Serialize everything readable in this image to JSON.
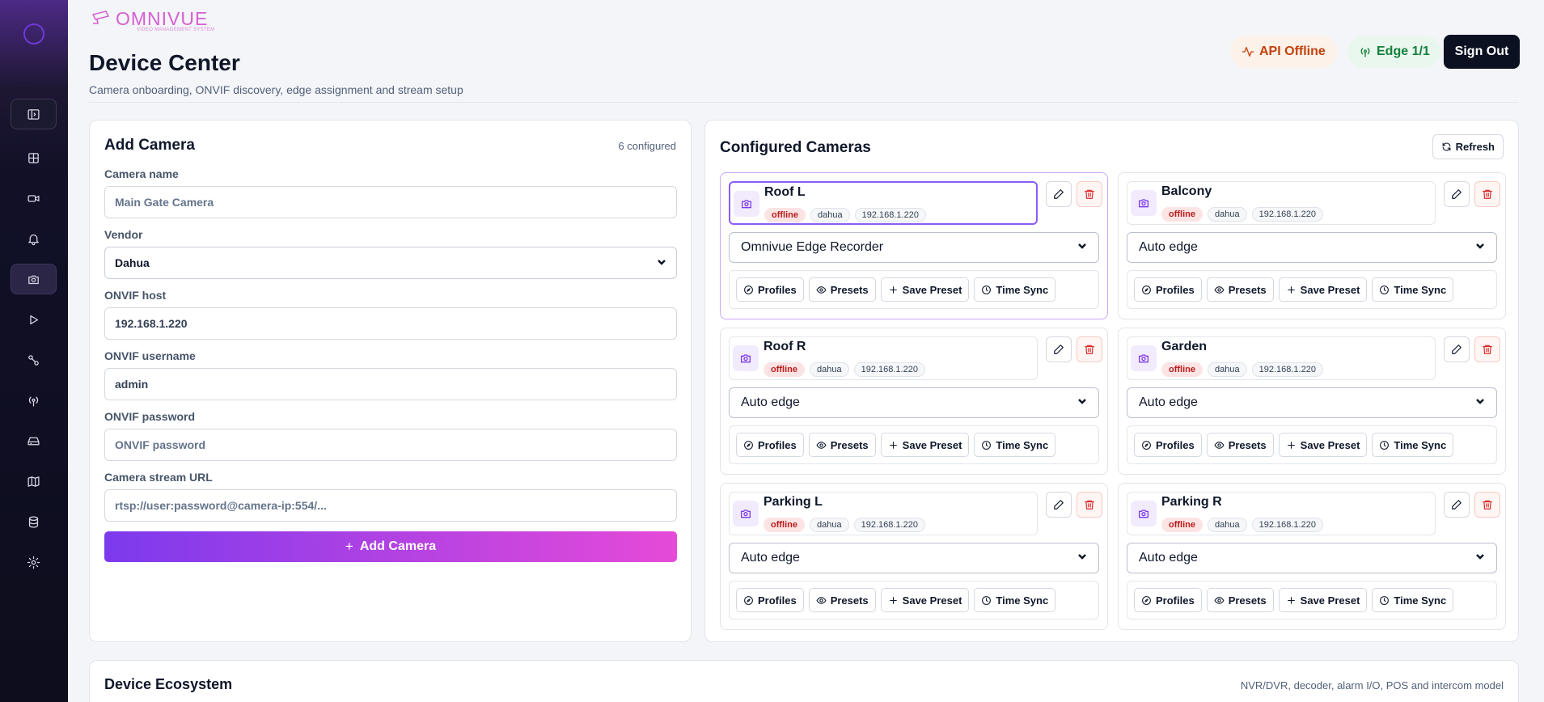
{
  "brand": {
    "name": "OMNIVUE",
    "tagline": "VIDEO MANAGEMENT SYSTEM"
  },
  "colors": {
    "accent": "#7c3aed",
    "accent_end": "#e64ad8",
    "danger": "#dc2626",
    "success": "#15803d",
    "warning": "#c2410c",
    "sidebar_bg": "#111027"
  },
  "sidebar": {
    "items": [
      {
        "icon": "sidebar-toggle-icon"
      },
      {
        "icon": "dashboard-grid-icon"
      },
      {
        "icon": "video-camera-icon"
      },
      {
        "icon": "bell-icon"
      },
      {
        "icon": "camera-icon",
        "active": true
      },
      {
        "icon": "play-icon"
      },
      {
        "icon": "workflow-icon"
      },
      {
        "icon": "antenna-icon"
      },
      {
        "icon": "storage-drive-icon"
      },
      {
        "icon": "map-icon"
      },
      {
        "icon": "database-icon"
      },
      {
        "icon": "gear-icon"
      }
    ]
  },
  "header": {
    "title": "Device Center",
    "subtitle": "Camera onboarding, ONVIF discovery, edge assignment and stream setup",
    "api_status": "API Offline",
    "edge_status": "Edge 1/1",
    "sign_out": "Sign Out"
  },
  "add_camera": {
    "title": "Add Camera",
    "configured_count": "6 configured",
    "fields": {
      "name_label": "Camera name",
      "name_placeholder": "Main Gate Camera",
      "vendor_label": "Vendor",
      "vendor_value": "Dahua",
      "host_label": "ONVIF host",
      "host_value": "192.168.1.220",
      "username_label": "ONVIF username",
      "username_value": "admin",
      "password_label": "ONVIF password",
      "password_placeholder": "ONVIF password",
      "url_label": "Camera stream URL",
      "url_placeholder": "rtsp://user:password@camera-ip:554/..."
    },
    "submit_label": "Add Camera"
  },
  "cameras_panel": {
    "title": "Configured Cameras",
    "refresh_label": "Refresh",
    "action_labels": {
      "profiles": "Profiles",
      "presets": "Presets",
      "save_preset": "Save Preset",
      "time_sync": "Time Sync"
    },
    "cameras": [
      {
        "name": "Roof L",
        "status": "offline",
        "vendor": "dahua",
        "ip": "192.168.1.220",
        "edge": "Omnivue Edge Recorder"
      },
      {
        "name": "Balcony",
        "status": "offline",
        "vendor": "dahua",
        "ip": "192.168.1.220",
        "edge": "Auto edge"
      },
      {
        "name": "Roof R",
        "status": "offline",
        "vendor": "dahua",
        "ip": "192.168.1.220",
        "edge": "Auto edge"
      },
      {
        "name": "Garden",
        "status": "offline",
        "vendor": "dahua",
        "ip": "192.168.1.220",
        "edge": "Auto edge"
      },
      {
        "name": "Parking L",
        "status": "offline",
        "vendor": "dahua",
        "ip": "192.168.1.220",
        "edge": "Auto edge"
      },
      {
        "name": "Parking R",
        "status": "offline",
        "vendor": "dahua",
        "ip": "192.168.1.220",
        "edge": "Auto edge"
      }
    ]
  },
  "ecosystem": {
    "title": "Device Ecosystem",
    "subtitle": "NVR/DVR, decoder, alarm I/O, POS and intercom model"
  }
}
